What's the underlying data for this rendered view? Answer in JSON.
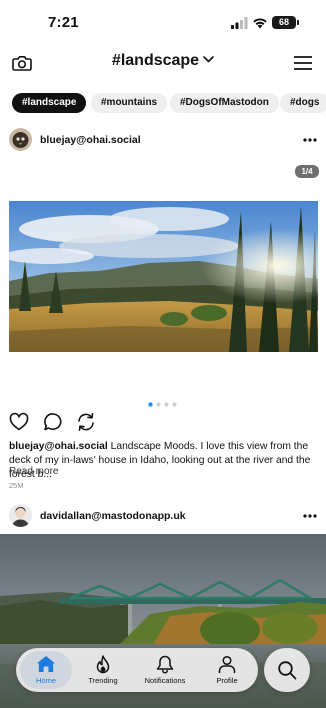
{
  "status_bar": {
    "time": "7:21",
    "battery": "68"
  },
  "header": {
    "title": "#landscape",
    "left_icon": "camera-icon",
    "title_icon": "chevron-down-icon",
    "right_icon": "menu-icon"
  },
  "tags": [
    {
      "label": "#landscape",
      "active": true
    },
    {
      "label": "#mountains",
      "active": false
    },
    {
      "label": "#DogsOfMastodon",
      "active": false
    },
    {
      "label": "#dogs",
      "active": false
    }
  ],
  "posts": [
    {
      "handle": "bluejay@ohai.social",
      "media_counter": "1/4",
      "carousel_count": 4,
      "carousel_active": 1,
      "caption_author": "bluejay@ohai.social",
      "caption_text": "Landscape Moods. I love this view from the deck of my in-laws' house in Idaho, looking out at the river and the forest b...",
      "read_more": "Read more",
      "time": "25M",
      "actions": [
        "heart-icon",
        "comment-icon",
        "boost-icon"
      ]
    },
    {
      "handle": "davidallan@mastodonapp.uk"
    }
  ],
  "tabbar": {
    "active_color": "#1e7be0",
    "items": [
      {
        "label": "Home",
        "icon": "home-icon",
        "active": true
      },
      {
        "label": "Trending",
        "icon": "flame-icon",
        "active": false
      },
      {
        "label": "Notifications",
        "icon": "bell-icon",
        "active": false
      },
      {
        "label": "Profile",
        "icon": "person-icon",
        "active": false
      }
    ],
    "search_icon": "search-icon"
  }
}
